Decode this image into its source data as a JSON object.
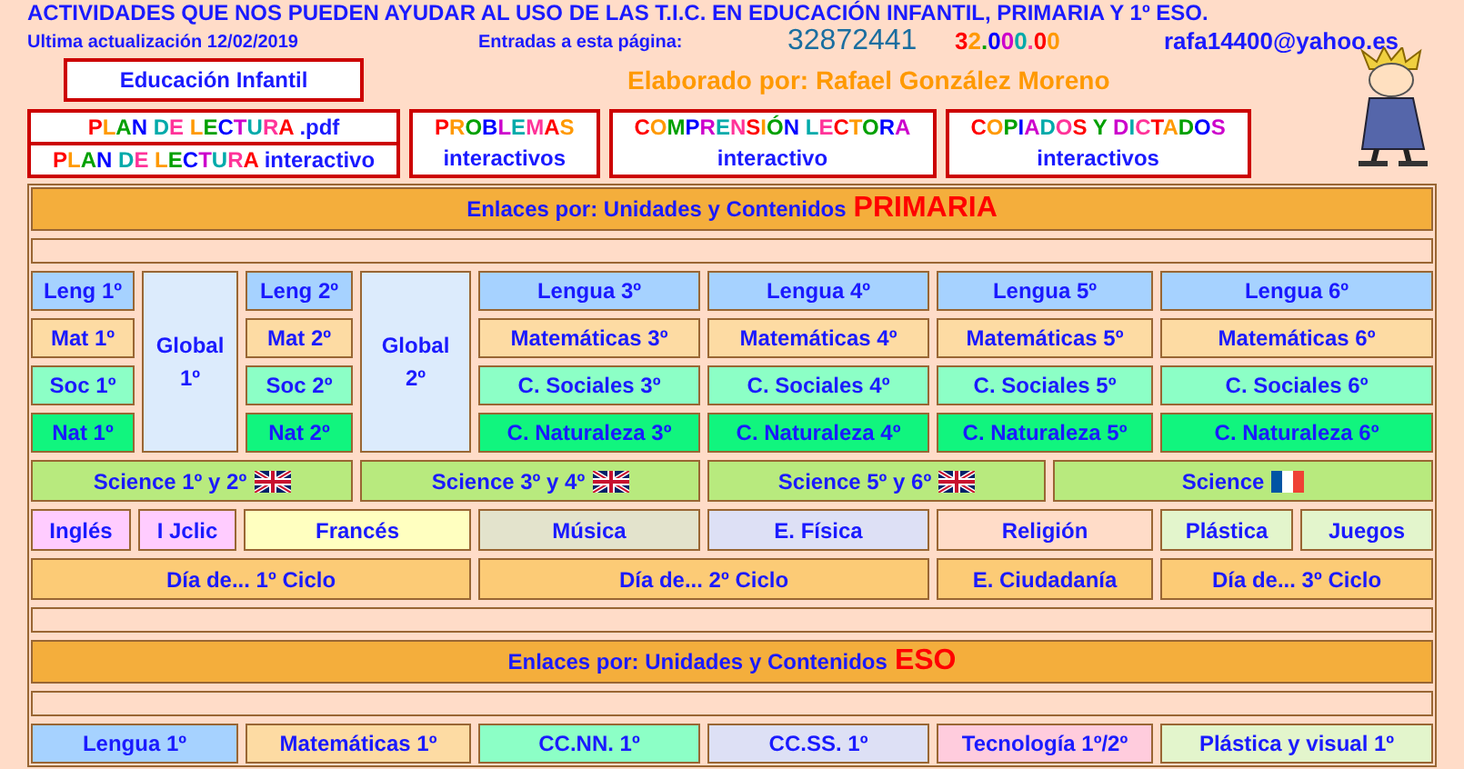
{
  "page_title": "ACTIVIDADES QUE NOS PUEDEN AYUDAR AL USO DE LAS T.I.C. EN EDUCACIÓN INFANTIL, PRIMARIA Y 1º ESO.",
  "last_update": "Ultima actualización 12/02/2019",
  "visits_label": "Entradas a esta página:",
  "visit_counter": "32872441",
  "counter_2": "32.000.00",
  "email": "rafa14400@yahoo.es",
  "infantil_link": "Educación Infantil",
  "author": "Elaborado por: Rafael González Moreno",
  "top_links": [
    {
      "kind": "split",
      "lines": [
        {
          "rainbow": "PLAN DE LECTURA",
          "plain": ".pdf"
        },
        {
          "rainbow": "PLAN DE LECTURA",
          "plain": "interactivo"
        }
      ]
    },
    {
      "kind": "joined",
      "lines": [
        {
          "rainbow": "PROBLEMAS"
        },
        {
          "plain": "interactivos"
        }
      ]
    },
    {
      "kind": "joined",
      "lines": [
        {
          "rainbow": "COMPRENSIÓN LECTORA"
        },
        {
          "plain": "interactivo"
        }
      ]
    },
    {
      "kind": "joined",
      "lines": [
        {
          "rainbow": "COPIADOS Y DICTADOS"
        },
        {
          "plain": "interactivos"
        }
      ]
    }
  ],
  "primaria": {
    "header": {
      "label": "Enlaces por: Unidades y Contenidos",
      "stage": "PRIMARIA"
    },
    "globals": [
      {
        "text": "Global 1º",
        "color": "#dcebfc"
      },
      {
        "text": "Global 2º",
        "color": "#dcebfc"
      }
    ],
    "grade_rows": [
      [
        {
          "text": "Leng 1º",
          "color": "#a6d2ff"
        },
        {
          "text": "Leng 2º",
          "color": "#a6d2ff"
        },
        {
          "text": "Lengua 3º",
          "color": "#a6d2ff"
        },
        {
          "text": "Lengua 4º",
          "color": "#a6d2ff"
        },
        {
          "text": "Lengua 5º",
          "color": "#a6d2ff"
        },
        {
          "text": "Lengua 6º",
          "color": "#a6d2ff"
        }
      ],
      [
        {
          "text": "Mat 1º",
          "color": "#fddba3"
        },
        {
          "text": "Mat 2º",
          "color": "#fddba3"
        },
        {
          "text": "Matemáticas 3º",
          "color": "#fddba3"
        },
        {
          "text": "Matemáticas 4º",
          "color": "#fddba3"
        },
        {
          "text": "Matemáticas 5º",
          "color": "#fddba3"
        },
        {
          "text": "Matemáticas 6º",
          "color": "#fddba3"
        }
      ],
      [
        {
          "text": "Soc 1º",
          "color": "#8cffc6"
        },
        {
          "text": "Soc 2º",
          "color": "#8cffc6"
        },
        {
          "text": "C. Sociales 3º",
          "color": "#8cffc6"
        },
        {
          "text": "C. Sociales 4º",
          "color": "#8cffc6"
        },
        {
          "text": "C. Sociales 5º",
          "color": "#8cffc6"
        },
        {
          "text": "C. Sociales 6º",
          "color": "#8cffc6"
        }
      ],
      [
        {
          "text": "Nat 1º",
          "color": "#11f57e"
        },
        {
          "text": "Nat 2º",
          "color": "#11f57e"
        },
        {
          "text": "C. Naturaleza 3º",
          "color": "#11f57e"
        },
        {
          "text": "C. Naturaleza 4º",
          "color": "#11f57e"
        },
        {
          "text": "C. Naturaleza 5º",
          "color": "#11f57e"
        },
        {
          "text": "C. Naturaleza 6º",
          "color": "#11f57e"
        }
      ]
    ],
    "science": [
      {
        "text": "Science 1º y 2º",
        "kind": "uk"
      },
      {
        "text": "Science 3º y 4º",
        "kind": "uk"
      },
      {
        "text": "Science 5º y 6º",
        "kind": "uk"
      },
      {
        "text": "Science",
        "kind": "fr"
      }
    ],
    "subjects": [
      {
        "text": "Inglés",
        "color": "#ffccff"
      },
      {
        "text": "I Jclic",
        "color": "#ffccff"
      },
      {
        "text": "Francés",
        "color": "#ffffc0"
      },
      {
        "text": "Música",
        "color": "#e3e3cc"
      },
      {
        "text": "E. Física",
        "color": "#dde0f5"
      },
      {
        "text": "Religión",
        "color": "#ffdcc8"
      },
      {
        "text": "Plástica",
        "color": "#e3f5cc"
      },
      {
        "text": "Juegos",
        "color": "#e3f5cc"
      }
    ],
    "days": [
      "Día de... 1º Ciclo",
      "Día de... 2º Ciclo",
      "E. Ciudadanía",
      "Día de... 3º Ciclo"
    ]
  },
  "eso": {
    "header": {
      "label": "Enlaces por: Unidades y Contenidos",
      "stage": "ESO"
    },
    "subjects": [
      {
        "text": "Lengua 1º",
        "color": "#a6d2ff"
      },
      {
        "text": "Matemáticas 1º",
        "color": "#fddba3"
      },
      {
        "text": "CC.NN. 1º",
        "color": "#8cffc6"
      },
      {
        "text": "CC.SS. 1º",
        "color": "#dde0f5"
      },
      {
        "text": "Tecnología 1º/2º",
        "color": "#ffccdd"
      },
      {
        "text": "Plástica y visual 1º",
        "color": "#e3f5cc"
      }
    ]
  }
}
